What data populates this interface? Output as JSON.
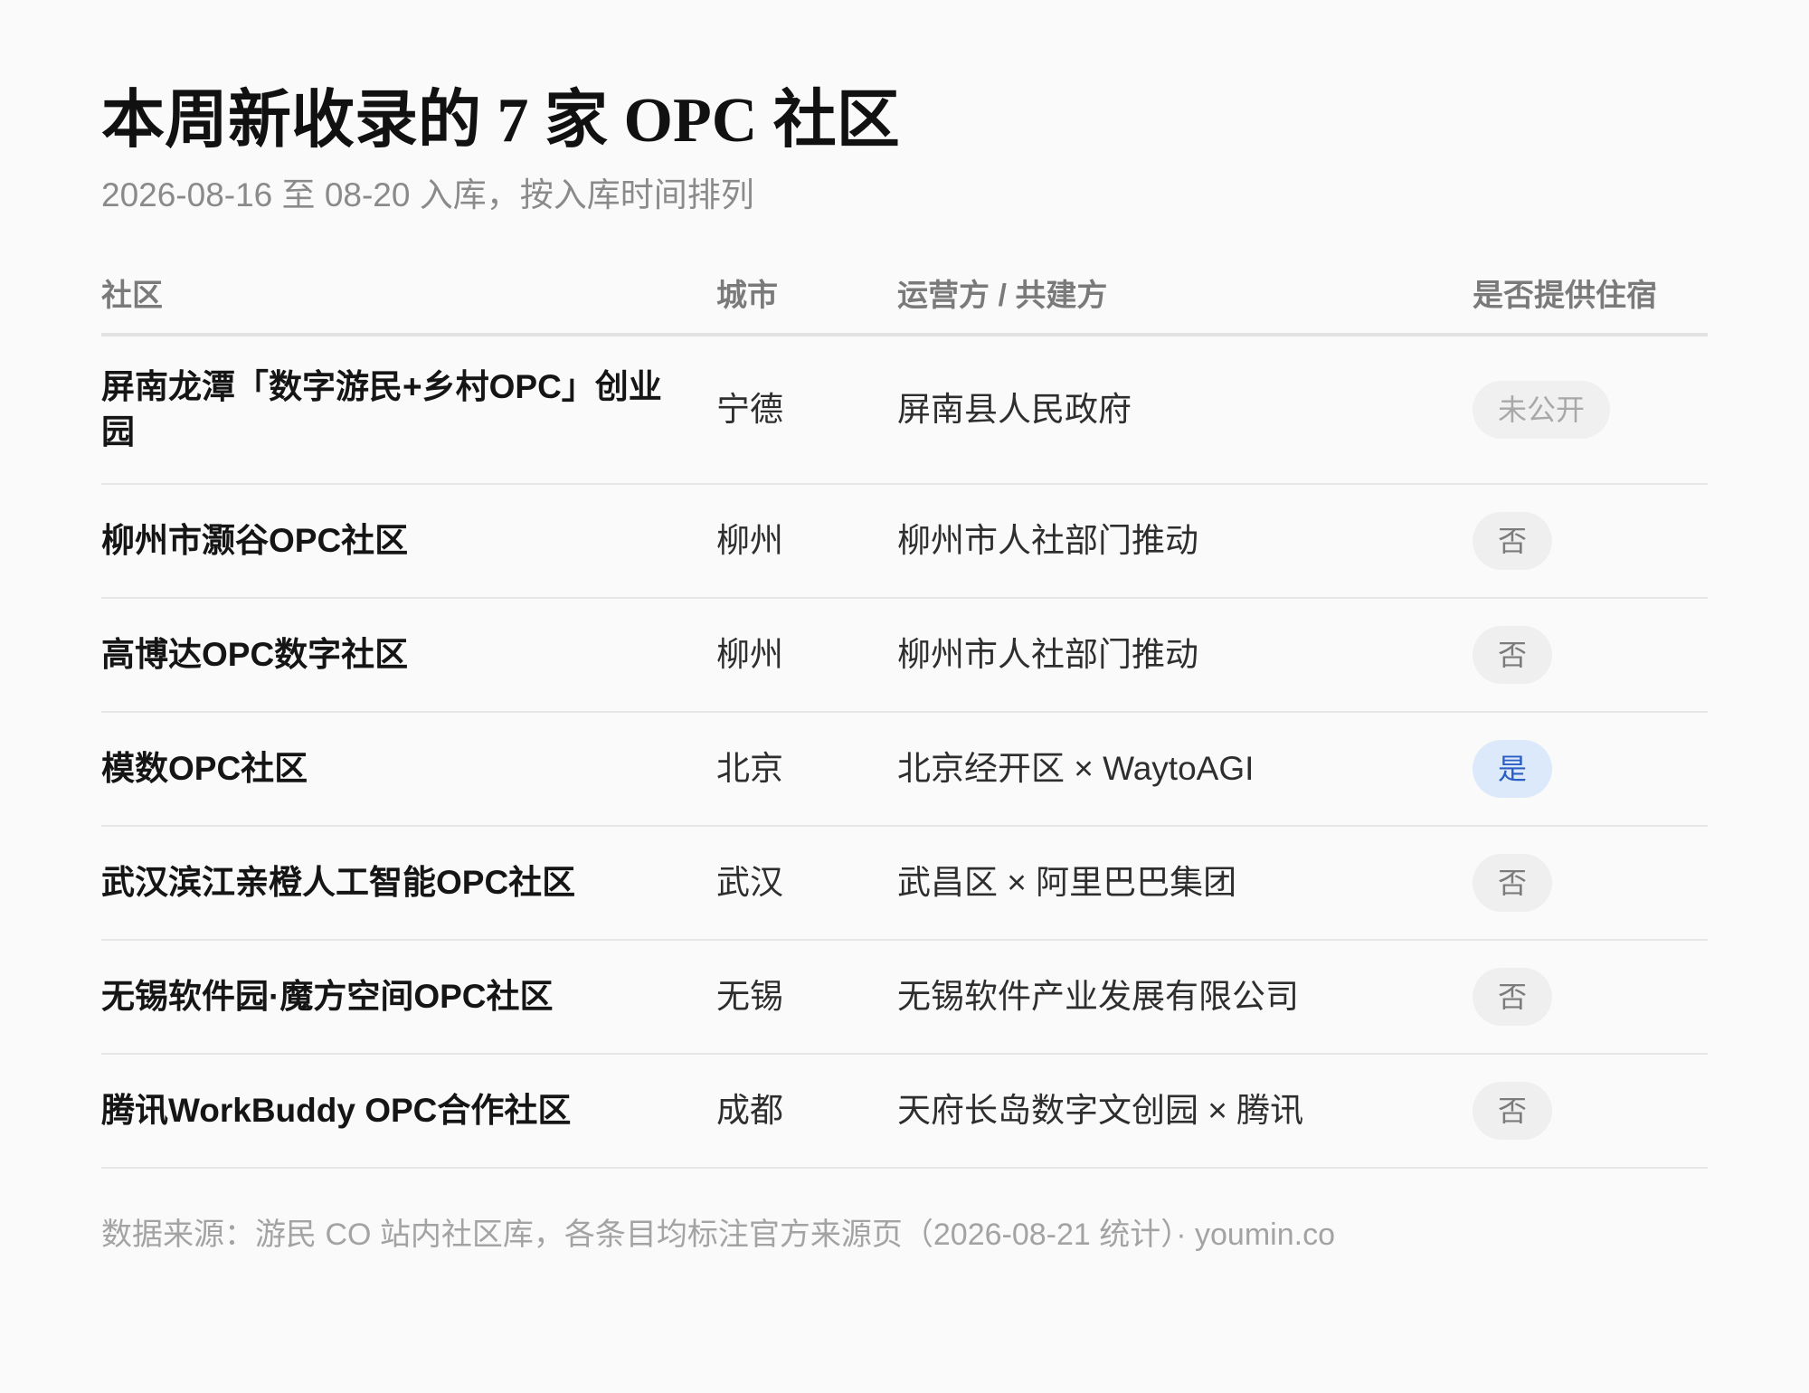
{
  "title": "本周新收录的 7 家 OPC 社区",
  "subtitle": "2026-08-16 至 08-20 入库，按入库时间排列",
  "columns": {
    "name": "社区",
    "city": "城市",
    "operator": "运营方 / 共建方",
    "lodging": "是否提供住宿"
  },
  "rows": [
    {
      "name": "屏南龙潭「数字游民+乡村OPC」创业园",
      "city": "宁德",
      "operator": "屏南县人民政府",
      "lodging": "未公开",
      "lodging_status": "undisclosed"
    },
    {
      "name": "柳州市灏谷OPC社区",
      "city": "柳州",
      "operator": "柳州市人社部门推动",
      "lodging": "否",
      "lodging_status": "no"
    },
    {
      "name": "高博达OPC数字社区",
      "city": "柳州",
      "operator": "柳州市人社部门推动",
      "lodging": "否",
      "lodging_status": "no"
    },
    {
      "name": "模数OPC社区",
      "city": "北京",
      "operator": "北京经开区 × WaytoAGI",
      "lodging": "是",
      "lodging_status": "yes"
    },
    {
      "name": "武汉滨江亲橙人工智能OPC社区",
      "city": "武汉",
      "operator": "武昌区 × 阿里巴巴集团",
      "lodging": "否",
      "lodging_status": "no"
    },
    {
      "name": "无锡软件园·魔方空间OPC社区",
      "city": "无锡",
      "operator": "无锡软件产业发展有限公司",
      "lodging": "否",
      "lodging_status": "no"
    },
    {
      "name": "腾讯WorkBuddy OPC合作社区",
      "city": "成都",
      "operator": "天府长岛数字文创园 × 腾讯",
      "lodging": "否",
      "lodging_status": "no"
    }
  ],
  "footer": "数据来源：游民 CO 站内社区库，各条目均标注官方来源页（2026-08-21 统计）· youmin.co",
  "colors": {
    "yes_bg": "#dce9fb",
    "yes_text": "#2b5fc4",
    "no_bg": "#efefef",
    "no_text": "#7b7b7b"
  }
}
